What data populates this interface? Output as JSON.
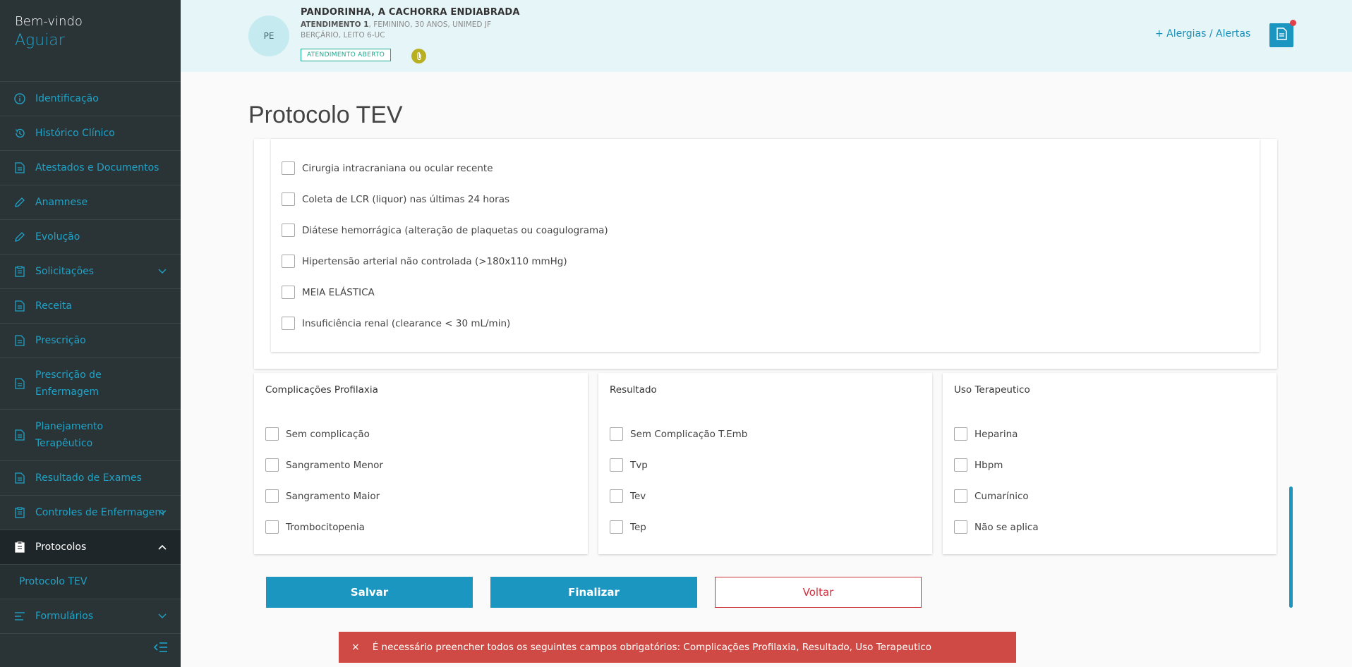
{
  "sidebar": {
    "welcome": "Bem-vindo",
    "user": "Aguiar",
    "items": [
      {
        "label": "Identificação",
        "icon": "info-icon"
      },
      {
        "label": "Histórico Clínico",
        "icon": "history-icon"
      },
      {
        "label": "Atestados e Documentos",
        "icon": "document-icon"
      },
      {
        "label": "Anamnese",
        "icon": "pencil-icon"
      },
      {
        "label": "Evolução",
        "icon": "pencil-icon"
      },
      {
        "label": "Solicitações",
        "icon": "clipboard-icon"
      },
      {
        "label": "Receita",
        "icon": "document-icon"
      },
      {
        "label": "Prescrição",
        "icon": "document-icon"
      },
      {
        "label": "Prescrição de Enfermagem",
        "icon": "document-icon"
      },
      {
        "label": "Planejamento Terapêutico",
        "icon": "document-icon"
      },
      {
        "label": "Resultado de Exames",
        "icon": "document-icon"
      },
      {
        "label": "Controles de Enfermagem",
        "icon": "clipboard-icon"
      },
      {
        "label": "Protocolos",
        "icon": "clipboard-icon"
      },
      {
        "label": "Protocolo TEV"
      },
      {
        "label": "Formulários",
        "icon": "list-icon"
      }
    ]
  },
  "header": {
    "avatar": "PE",
    "patient_name": "PANDORINHA, A CACHORRA ENDIABRADA",
    "atendimento_label": "ATENDIMENTO 1",
    "info_rest": ", FEMININO, 30 ANOS, UNIMED JF",
    "location": "BERÇÁRIO, LEITO 6-UC",
    "status_badge": "ATENDIMENTO ABERTO",
    "alerts_link": "+  Alergias / Alertas"
  },
  "page": {
    "title": "Protocolo TEV"
  },
  "main_checkboxes": [
    "Cirurgia intracraniana ou ocular recente",
    "Coleta de LCR (liquor) nas últimas 24 horas",
    "Diátese hemorrágica (alteração de plaquetas ou coagulograma)",
    "Hipertensão arterial não controlada (>180x110 mmHg)",
    "MEIA ELÁSTICA",
    "Insuficiência renal (clearance < 30 mL/min)"
  ],
  "cards": [
    {
      "title": "Complicações Profilaxia",
      "options": [
        "Sem complicação",
        "Sangramento Menor",
        "Sangramento Maior",
        "Trombocitopenia"
      ]
    },
    {
      "title": "Resultado",
      "options": [
        "Sem Complicação T.Emb",
        "Tvp",
        "Tev",
        "Tep"
      ]
    },
    {
      "title": "Uso Terapeutico",
      "options": [
        "Heparina",
        "Hbpm",
        "Cumarínico",
        "Não se aplica"
      ]
    }
  ],
  "buttons": {
    "save": "Salvar",
    "finish": "Finalizar",
    "back": "Voltar"
  },
  "toast": {
    "close": "×",
    "message": "É necessário preencher todos os seguintes campos obrigatórios: Complicações Profilaxia, Resultado, Uso Terapeutico"
  },
  "colors": {
    "accent": "#1a96c0",
    "sidebar_bg": "#2a3336",
    "header_bg": "#e6f5f7",
    "danger": "#cf4a44"
  }
}
